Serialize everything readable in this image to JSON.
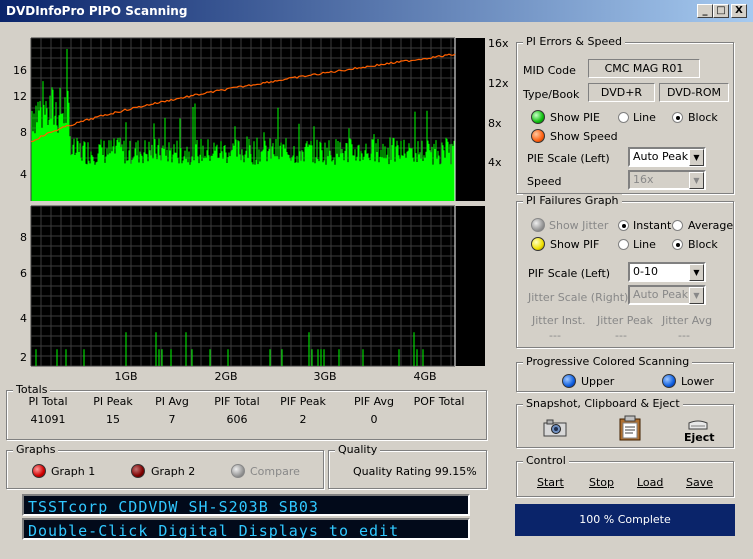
{
  "window": {
    "title": "DVDInfoPro PIPO Scanning",
    "min": "_",
    "max": "□",
    "close": "X"
  },
  "graph_top": {
    "y_left_ticks": [
      "16",
      "12",
      "8",
      "4"
    ],
    "y_right_ticks": [
      "16x",
      "12x",
      "8x",
      "4x"
    ]
  },
  "graph_bottom": {
    "y_ticks": [
      "8",
      "6",
      "4",
      "2"
    ],
    "x_ticks": [
      "1GB",
      "2GB",
      "3GB",
      "4GB"
    ]
  },
  "totals": {
    "label": "Totals",
    "headers": [
      "PI Total",
      "PI Peak",
      "PI Avg",
      "PIF Total",
      "PIF Peak",
      "PIF Avg",
      "POF Total"
    ],
    "values": [
      "41091",
      "15",
      "7",
      "606",
      "2",
      "0",
      ""
    ]
  },
  "graphs": {
    "label": "Graphs",
    "graph1": "Graph 1",
    "graph2": "Graph 2",
    "compare": "Compare"
  },
  "quality": {
    "label": "Quality",
    "text": "Quality Rating 99.15%"
  },
  "lcd": {
    "line1": "TSSTcorp CDDVDW SH-S203B SB03",
    "line2": "Double-Click Digital Displays to edit"
  },
  "pi_errors": {
    "label": "PI Errors & Speed",
    "mid_label": "MID Code",
    "mid_value": "CMC MAG R01",
    "type_label": "Type/Book",
    "type_value": "DVD+R",
    "book_value": "DVD-ROM",
    "show_pie": "Show PIE",
    "line": "Line",
    "block": "Block",
    "show_speed": "Show Speed",
    "pie_scale_label": "PIE Scale (Left)",
    "pie_scale_value": "Auto Peak",
    "speed_label": "Speed",
    "speed_value": "16x"
  },
  "pi_failures": {
    "label": "PI Failures Graph",
    "show_jitter": "Show Jitter",
    "instant": "Instant",
    "average": "Average",
    "show_pif": "Show PIF",
    "line": "Line",
    "block": "Block",
    "pif_scale_label": "PIF Scale (Left)",
    "pif_scale_value": "0-10",
    "jitter_scale_label": "Jitter Scale (Right)",
    "jitter_scale_value": "Auto Peak",
    "jitter_inst": "Jitter Inst.",
    "jitter_peak": "Jitter Peak",
    "jitter_avg": "Jitter Avg",
    "jitter_inst_val": "---",
    "jitter_peak_val": "---",
    "jitter_avg_val": "---"
  },
  "progressive": {
    "label": "Progressive Colored Scanning",
    "upper": "Upper",
    "lower": "Lower"
  },
  "snapshot": {
    "label": "Snapshot,  Clipboard  & Eject",
    "eject": "Eject"
  },
  "control": {
    "label": "Control",
    "start": "Start",
    "stop": "Stop",
    "load": "Load",
    "save": "Save"
  },
  "progress": {
    "text": "100 % Complete",
    "value": 100
  },
  "colors": {
    "pie": "#00ff00",
    "speed": "#ff6000",
    "pif": "#00ff00",
    "grid": "#3c3c3c",
    "status_bg": "#0a246a"
  }
}
